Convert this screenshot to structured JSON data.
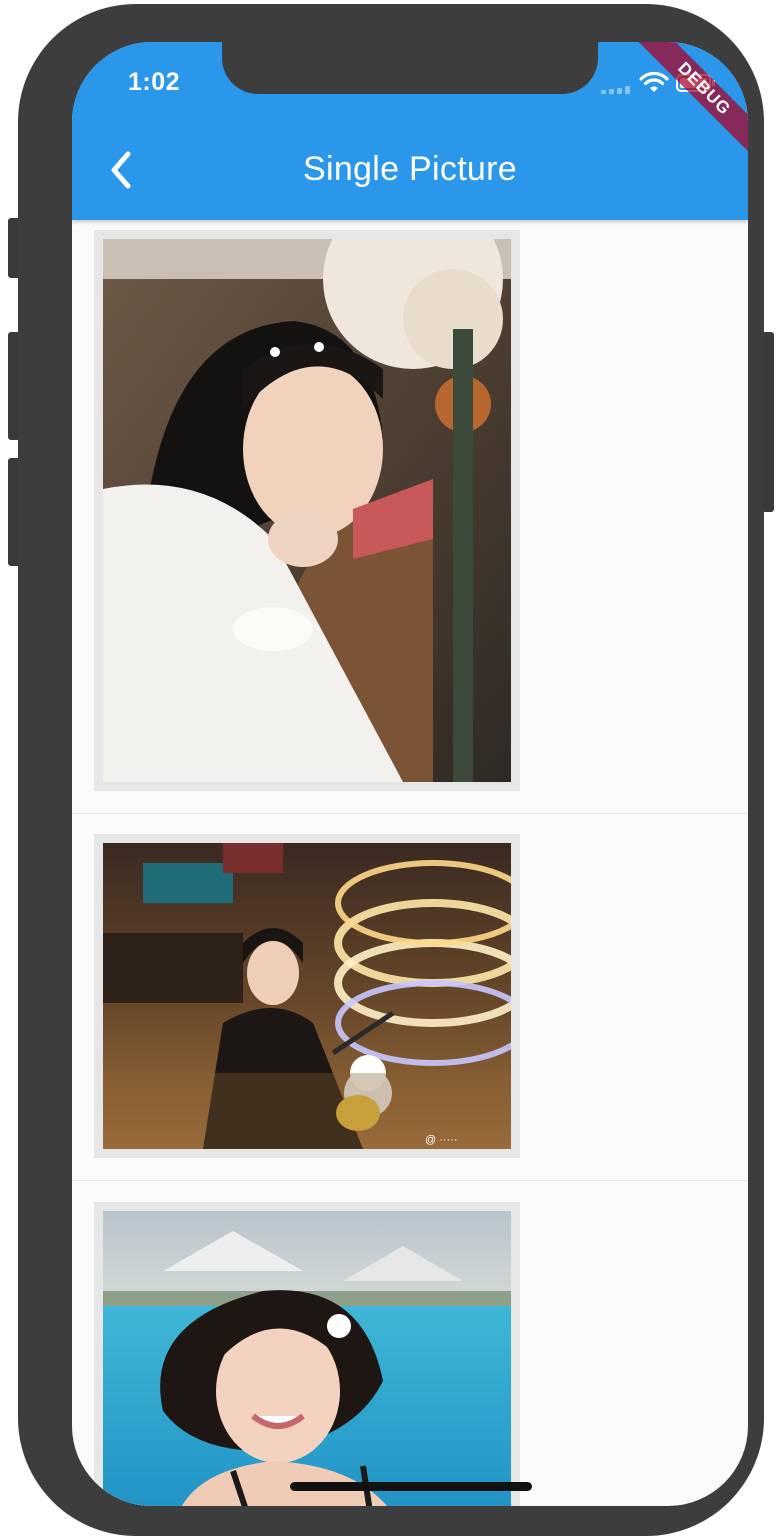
{
  "status_bar": {
    "time": "1:02"
  },
  "debug_banner": "DEBUG",
  "app_bar": {
    "title": "Single Picture",
    "back_icon": "chevron-left-icon"
  },
  "photos": [
    {
      "name": "photo-girl-with-book",
      "watermark": ""
    },
    {
      "name": "photo-girl-selfie-lights",
      "watermark": "@ ·····"
    },
    {
      "name": "photo-girl-pool",
      "watermark": ""
    }
  ],
  "colors": {
    "app_bar": "#2b97ea",
    "background": "#fafafa",
    "frame": "#e6e6e6"
  }
}
